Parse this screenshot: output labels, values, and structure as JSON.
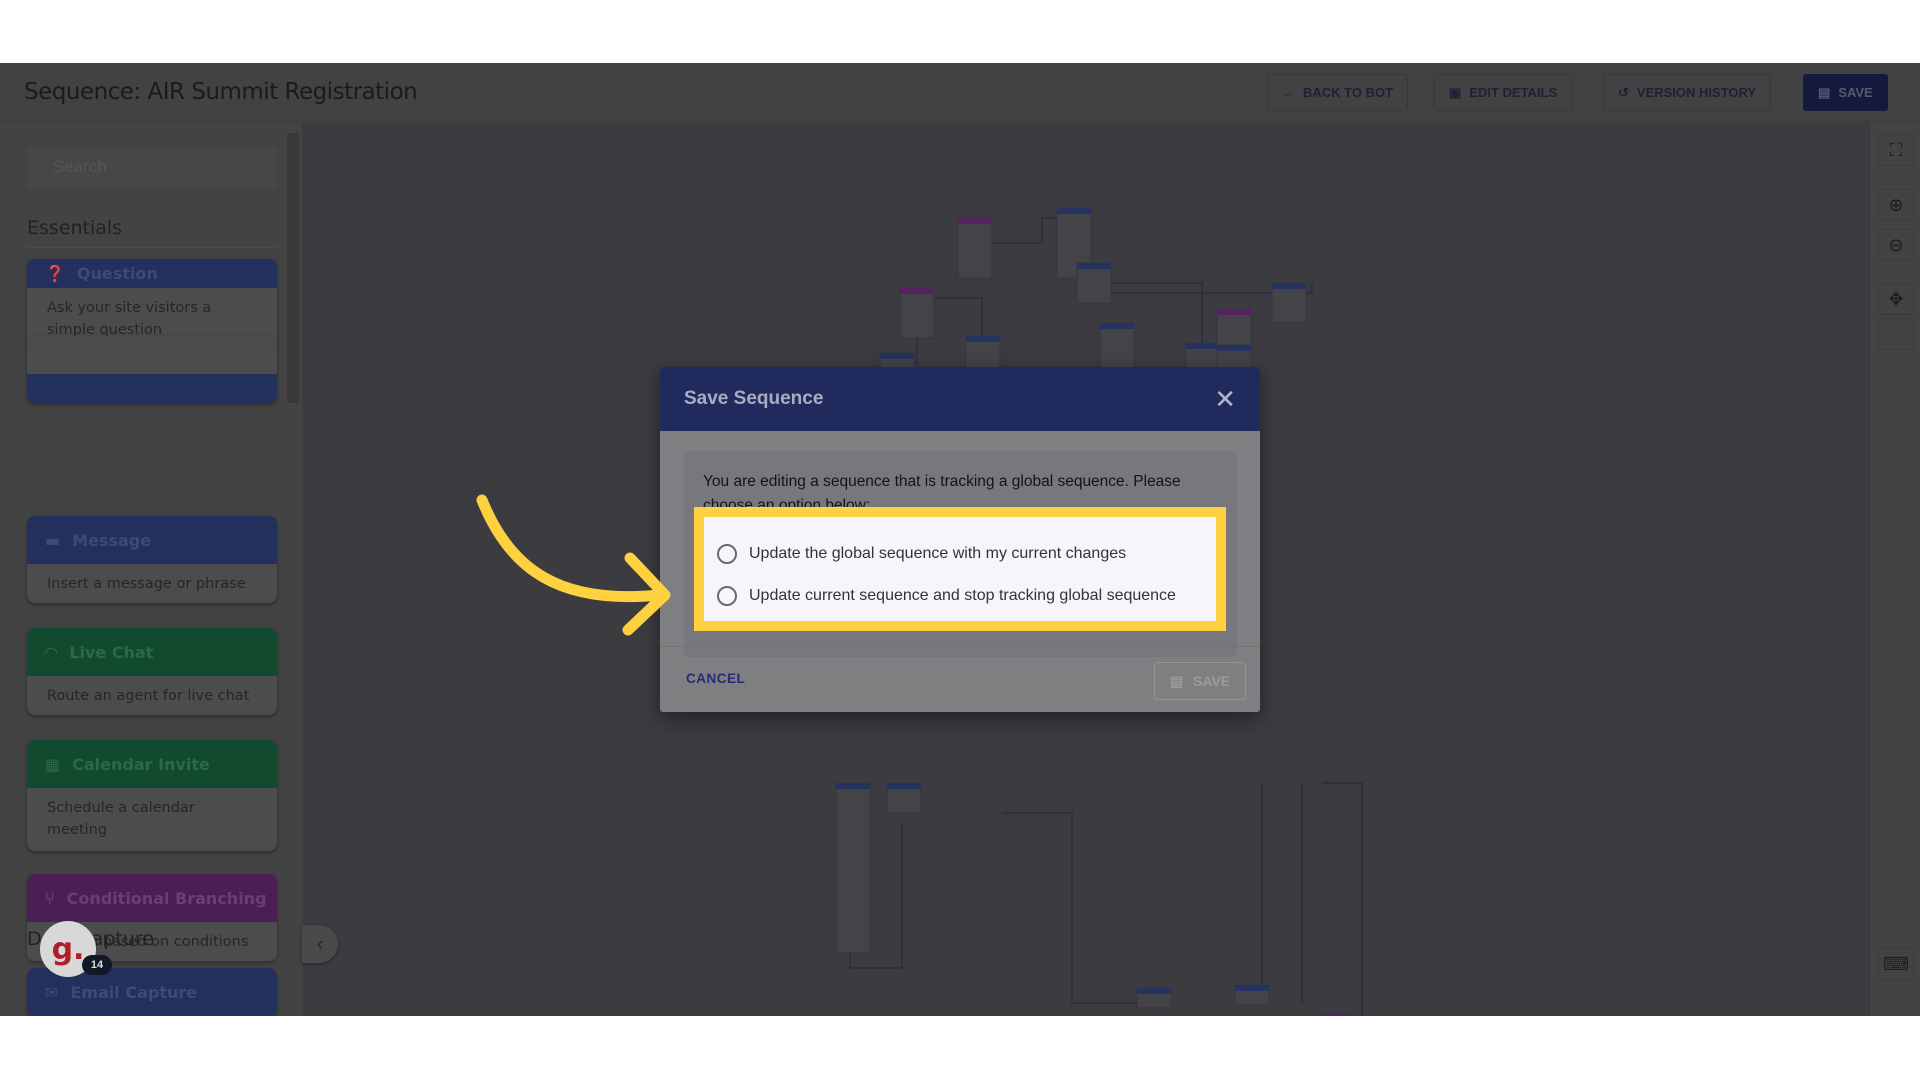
{
  "header": {
    "title": "Sequence: AIR Summit Registration",
    "buttons": [
      {
        "label": "Back to bot",
        "icon": "arrow-left-icon"
      },
      {
        "label": "Edit details",
        "icon": "edit-icon"
      },
      {
        "label": "Version history",
        "icon": "history-icon"
      },
      {
        "label": "Save",
        "icon": "save-icon"
      }
    ]
  },
  "sidebar": {
    "search_placeholder": "Search",
    "sections": [
      {
        "title": "Essentials",
        "items": [
          {
            "title": "Question",
            "description": "Ask your site visitors a simple question",
            "color": "#3f5bb8",
            "icon": "question-icon"
          },
          {
            "title": "Message",
            "description": "Insert a message or phrase",
            "color": "#3f5bb8",
            "icon": "message-icon"
          },
          {
            "title": "Live Chat",
            "description": "Route an agent for live chat",
            "color": "#1f9a5c",
            "icon": "headset-icon"
          },
          {
            "title": "Calendar Invite",
            "description": "Schedule a calendar meeting",
            "color": "#1f9a5c",
            "icon": "calendar-icon"
          },
          {
            "title": "Conditional Branching",
            "description": "Branch based on conditions",
            "color": "#8e3aa6",
            "icon": "branch-icon"
          }
        ]
      },
      {
        "title": "Data Capture",
        "items": [
          {
            "title": "Email Capture",
            "color": "#3f5bb8",
            "icon": "email-icon"
          }
        ]
      }
    ]
  },
  "avatar": {
    "letter": "g.",
    "badge": "14"
  },
  "modal": {
    "title": "Save Sequence",
    "message": "You are editing a sequence that is tracking a global sequence. Please choose an option below:",
    "options": [
      {
        "label": "Update the global sequence with my current changes",
        "selected": false
      },
      {
        "label": "Update current sequence and stop tracking global sequence",
        "selected": false
      }
    ],
    "cancel_label": "Cancel",
    "save_label": "Save",
    "highlight_color": "#fdd13f"
  }
}
